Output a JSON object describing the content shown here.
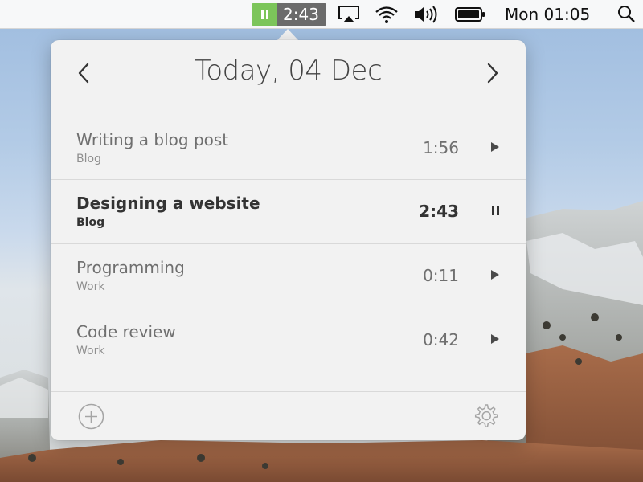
{
  "menubar": {
    "timer": {
      "time": "2:43",
      "state_icon": "pause-icon",
      "accent": "#7cc55a"
    },
    "icons": [
      "airplay-icon",
      "wifi-icon",
      "volume-icon",
      "battery-icon",
      "spotlight-search-icon"
    ],
    "clock": "Mon 01:05"
  },
  "popover": {
    "date_title": "Today, 04 Dec",
    "prev_icon": "chevron-left-icon",
    "next_icon": "chevron-right-icon",
    "tasks": [
      {
        "name": "Writing a blog post",
        "category": "Blog",
        "time": "1:56",
        "action_icon": "play-icon",
        "active": false
      },
      {
        "name": "Designing a website",
        "category": "Blog",
        "time": "2:43",
        "action_icon": "pause-icon",
        "active": true
      },
      {
        "name": "Programming",
        "category": "Work",
        "time": "0:11",
        "action_icon": "play-icon",
        "active": false
      },
      {
        "name": "Code review",
        "category": "Work",
        "time": "0:42",
        "action_icon": "play-icon",
        "active": false
      }
    ],
    "footer": {
      "add_icon": "add-circle-icon",
      "settings_icon": "gear-icon"
    }
  }
}
